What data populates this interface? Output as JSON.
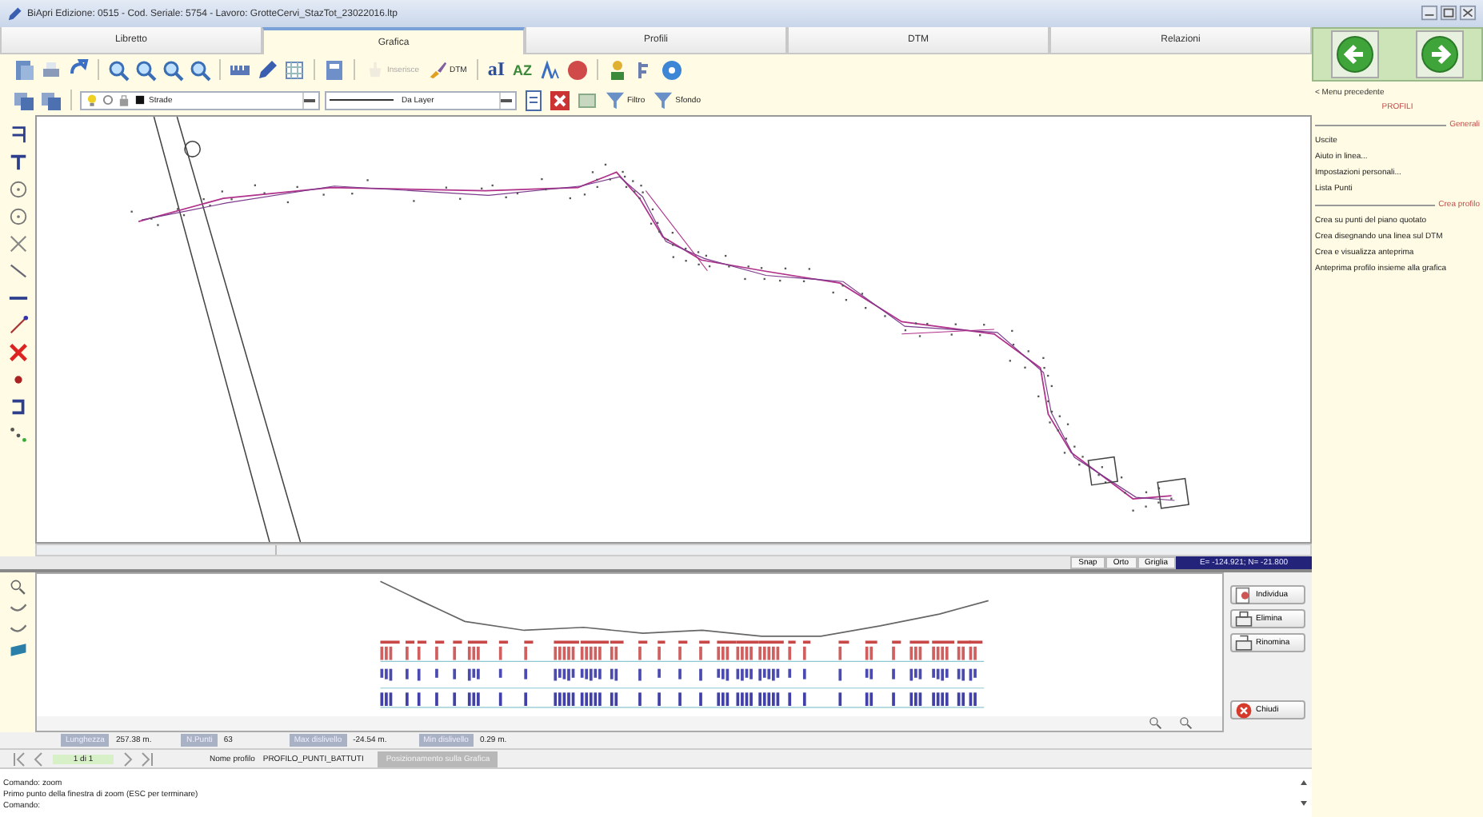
{
  "window": {
    "title": "BiApri Edizione: 0515 - Cod. Seriale: 5754 - Lavoro: GrotteCervi_StazTot_23022016.ltp"
  },
  "tabs": [
    {
      "label": "Libretto",
      "selected": false
    },
    {
      "label": "Grafica",
      "selected": true
    },
    {
      "label": "Profili",
      "selected": false
    },
    {
      "label": "DTM",
      "selected": false
    },
    {
      "label": "Relazioni",
      "selected": false
    }
  ],
  "toolbar_1": {
    "buttons": [
      {
        "label": "Inserisce",
        "disabled": true
      },
      {
        "label": "DTM",
        "disabled": false
      },
      {
        "label": "aI"
      },
      {
        "label": "AZ"
      }
    ]
  },
  "toolbar_2": {
    "layer_combo": {
      "value": "Strade"
    },
    "linetype_combo": {
      "value": "Da Layer"
    },
    "buttons": [
      {
        "label": "Filtro",
        "disabled": false
      },
      {
        "label": "Sfondo",
        "disabled": false
      }
    ]
  },
  "status_bar": {
    "toggles": [
      {
        "label": "Snap"
      },
      {
        "label": "Orto"
      },
      {
        "label": "Griglia"
      }
    ],
    "coordinates": "E= -124.921; N= -21.800"
  },
  "profile_panel": {
    "buttons": [
      {
        "label": "Individua"
      },
      {
        "label": "Elimina"
      },
      {
        "label": "Rinomina"
      },
      {
        "label": "Chiudi"
      }
    ],
    "stats": [
      {
        "label": "Lunghezza",
        "value": "257.38 m."
      },
      {
        "label": "N.Punti",
        "value": "63"
      },
      {
        "label": "Max dislivello",
        "value": "-24.54 m."
      },
      {
        "label": "Min dislivello",
        "value": "0.29 m."
      }
    ],
    "navigator": {
      "page": "1 di 1",
      "profile_label": "Nome profilo",
      "profile_name": "PROFILO_PUNTI_BATTUTI",
      "position_button": {
        "label": "Posizionamento sulla Grafica",
        "disabled": true
      }
    }
  },
  "command_lines": [
    "Comando: zoom",
    "Primo punto della finestra di zoom (ESC per terminare)",
    "Comando:"
  ],
  "side_menu": {
    "back_link": "< Menu precedente",
    "title": "PROFILI",
    "sections": [
      {
        "heading": "Generali",
        "items": [
          "Uscite",
          "Aiuto in linea...",
          "Impostazioni personali...",
          "Lista Punti"
        ]
      },
      {
        "heading": "Crea profilo",
        "items": [
          "Crea su punti del piano quotato",
          "Crea disegnando una linea sul DTM",
          "Crea e visualizza anteprima",
          "Anteprima profilo insieme alla grafica"
        ]
      }
    ]
  }
}
